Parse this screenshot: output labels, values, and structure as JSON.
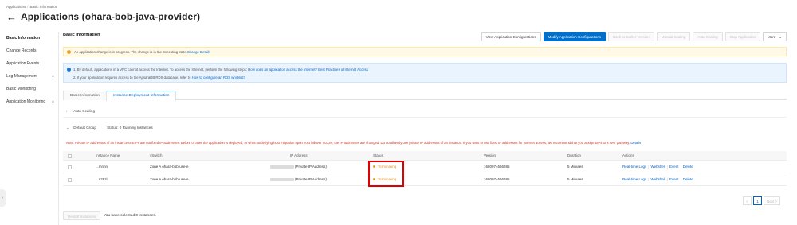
{
  "breadcrumb": [
    "Applications",
    "/",
    "Basic Information"
  ],
  "page_title": "Applications (ohara-bob-java-provider)",
  "sidebar": {
    "items": [
      {
        "label": "Basic Information",
        "active": true,
        "expandable": false
      },
      {
        "label": "Change Records",
        "active": false,
        "expandable": false
      },
      {
        "label": "Application Events",
        "active": false,
        "expandable": false
      },
      {
        "label": "Log Management",
        "active": false,
        "expandable": true
      },
      {
        "label": "Basic Monitoring",
        "active": false,
        "expandable": false
      },
      {
        "label": "Application Monitoring",
        "active": false,
        "expandable": true
      }
    ]
  },
  "section_title": "Basic Information",
  "toolbar": {
    "view_config": "View Application Configurations",
    "modify_config": "Modify Application Configurations",
    "rollback": "Back to Earlier Version",
    "manual_scaling": "Manual Scaling",
    "auto_scaling": "Auto Scaling",
    "stop": "Stop Application",
    "more": "More"
  },
  "alert_warning": {
    "text": "An application change is in progress. The change is in the Executing state.",
    "link": "Change Details"
  },
  "alert_info": {
    "line1_text": "1. By default, applications in a VPC cannot access the Internet. To access the Internet, perform the following steps:",
    "line1_link1": "How does an application access the Internet?",
    "line1_link2": "Best Practices of Internet Access",
    "line2_text": "2. If your application requires access to the ApsaraDB RDS database, refer to",
    "line2_link": "How to configure an RDS whitelist?"
  },
  "tabs": [
    {
      "label": "Basic Information",
      "active": false
    },
    {
      "label": "Instance Deployment Information",
      "active": true
    }
  ],
  "auto_scaling_label": "Auto Scaling",
  "group": {
    "name": "Default Group",
    "status": "Status: 0 Running Instances"
  },
  "note": {
    "text": "Note: Private IP addresses of an instance or EIPs are not fixed IP addresses. Before or after the application is deployed, or when underlying host migration upon host failover occurs, the IP addresses are changed. Do not directly use private IP addresses of an instance. If you want to use fixed IP addresses for Internet access, we recommend that you assign EIPs to a NAT gateway.",
    "link": "Details"
  },
  "table": {
    "columns": [
      "Instance Name",
      "vSwitch",
      "IP Address",
      "Status",
      "Version",
      "Duration",
      "Actions"
    ],
    "rows": [
      {
        "name": "...mnnnj",
        "vswitch": "Zone A ohara-bob-use-e",
        "ip_suffix": "(Private IP Address)",
        "status": "Terminating",
        "version": "1680074656585",
        "duration": "5 Minutes"
      },
      {
        "name": "...n28zl",
        "vswitch": "Zone A ohara-bob-use-e",
        "ip_suffix": "(Private IP Address)",
        "status": "Terminating",
        "version": "1680074656585",
        "duration": "5 Minutes"
      }
    ],
    "actions": [
      "Real-time Logs",
      "Webshell",
      "Event",
      "Delete"
    ]
  },
  "pager": {
    "prev": "<",
    "current": "1",
    "next": "Next",
    "next_arrow": ">"
  },
  "footer": {
    "restart_label": "Restart Instances",
    "selected_text": "You have selected 0 instances."
  },
  "colors": {
    "primary": "#0070cc",
    "link": "#0064c8",
    "warning_bg": "#fff9e6",
    "info_bg": "#eaf4fe",
    "note_red": "#d93026",
    "status_orange": "#f0a020",
    "highlight_red": "#e00000"
  }
}
